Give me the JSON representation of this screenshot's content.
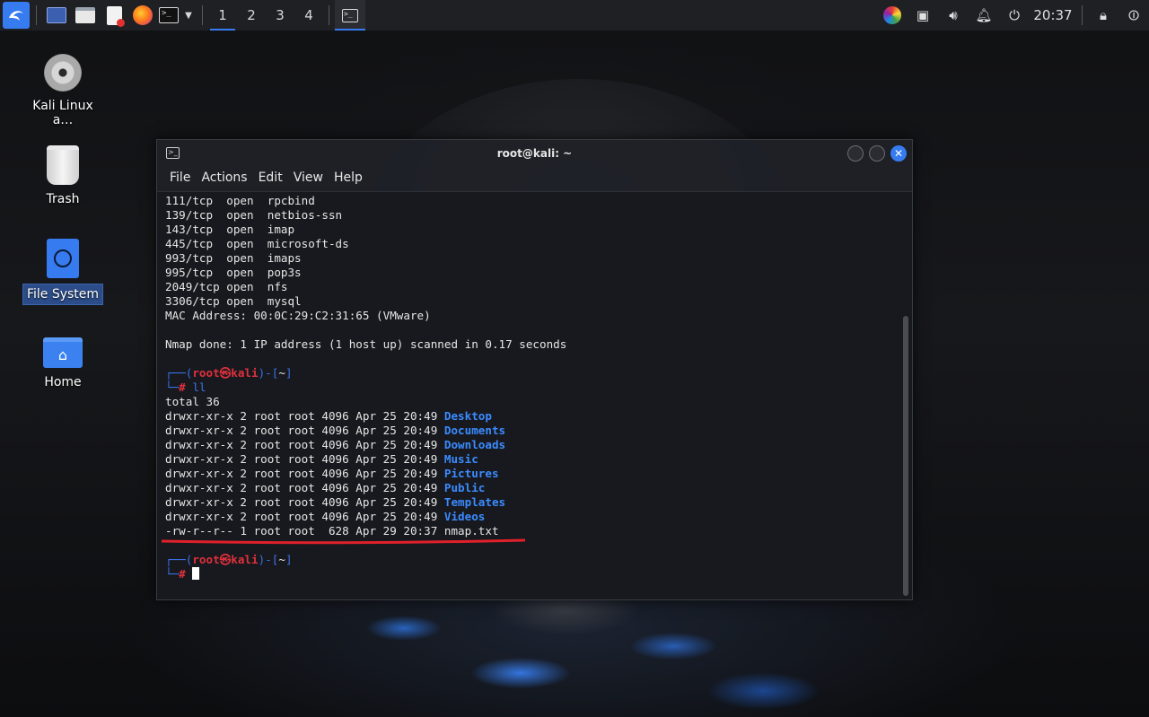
{
  "panel": {
    "workspaces": [
      "1",
      "2",
      "3",
      "4"
    ],
    "clock": "20:37"
  },
  "desktop": {
    "icons": [
      {
        "label": "Kali Linux a…"
      },
      {
        "label": "Trash"
      },
      {
        "label": "File System"
      },
      {
        "label": "Home"
      }
    ]
  },
  "terminal": {
    "title": "root@kali: ~",
    "menu": [
      "File",
      "Actions",
      "Edit",
      "View",
      "Help"
    ],
    "ports": [
      {
        "port": "111/tcp ",
        "state": "open",
        "service": "rpcbind"
      },
      {
        "port": "139/tcp ",
        "state": "open",
        "service": "netbios-ssn"
      },
      {
        "port": "143/tcp ",
        "state": "open",
        "service": "imap"
      },
      {
        "port": "445/tcp ",
        "state": "open",
        "service": "microsoft-ds"
      },
      {
        "port": "993/tcp ",
        "state": "open",
        "service": "imaps"
      },
      {
        "port": "995/tcp ",
        "state": "open",
        "service": "pop3s"
      },
      {
        "port": "2049/tcp",
        "state": "open",
        "service": "nfs"
      },
      {
        "port": "3306/tcp",
        "state": "open",
        "service": "mysql"
      }
    ],
    "mac_line": "MAC Address: 00:0C:29:C2:31:65 (VMware)",
    "nmap_done": "Nmap done: 1 IP address (1 host up) scanned in 0.17 seconds",
    "prompt": {
      "user": "root",
      "at": "㉿",
      "host": "kali",
      "dir": "~",
      "symbol": "#"
    },
    "command": "ll",
    "total": "total 36",
    "listing": [
      {
        "meta": "drwxr-xr-x 2 root root 4096 Apr 25 20:49 ",
        "name": "Desktop",
        "dir": true
      },
      {
        "meta": "drwxr-xr-x 2 root root 4096 Apr 25 20:49 ",
        "name": "Documents",
        "dir": true
      },
      {
        "meta": "drwxr-xr-x 2 root root 4096 Apr 25 20:49 ",
        "name": "Downloads",
        "dir": true
      },
      {
        "meta": "drwxr-xr-x 2 root root 4096 Apr 25 20:49 ",
        "name": "Music",
        "dir": true
      },
      {
        "meta": "drwxr-xr-x 2 root root 4096 Apr 25 20:49 ",
        "name": "Pictures",
        "dir": true
      },
      {
        "meta": "drwxr-xr-x 2 root root 4096 Apr 25 20:49 ",
        "name": "Public",
        "dir": true
      },
      {
        "meta": "drwxr-xr-x 2 root root 4096 Apr 25 20:49 ",
        "name": "Templates",
        "dir": true
      },
      {
        "meta": "drwxr-xr-x 2 root root 4096 Apr 25 20:49 ",
        "name": "Videos",
        "dir": true
      },
      {
        "meta": "-rw-r--r-- 1 root root  628 Apr 29 20:37 ",
        "name": "nmap.txt",
        "dir": false
      }
    ]
  },
  "colors": {
    "accent": "#367bf0",
    "prompt_red": "#e0303c",
    "dir_blue": "#3b8bff",
    "annotation_red": "#e0202a"
  },
  "icons": {
    "panel": [
      "kali-menu-icon",
      "show-desktop-icon",
      "file-manager-icon",
      "text-editor-icon",
      "firefox-icon",
      "terminal-icon",
      "chevron-down-icon"
    ],
    "tray": [
      "color-picker-icon",
      "display-icon",
      "volume-icon",
      "bell-icon",
      "power-manager-icon",
      "lock-icon",
      "logout-icon"
    ]
  }
}
